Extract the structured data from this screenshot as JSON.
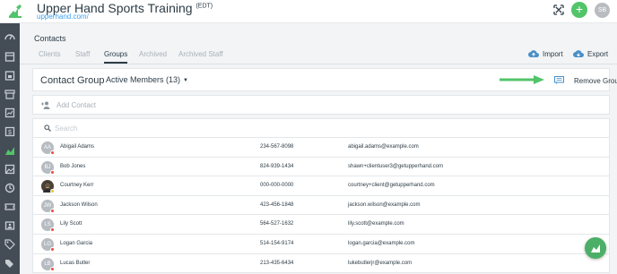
{
  "header": {
    "title": "Upper Hand Sports Training",
    "title_sup": "(EDT)",
    "subtitle": "upperhand.com/",
    "add_label": "+",
    "user_initials": "SB"
  },
  "sidebar": {
    "icons": [
      "dashboard-icon",
      "calendar-icon",
      "events-icon",
      "store-icon",
      "reports-icon",
      "money-icon",
      "contacts-icon",
      "image-icon",
      "clock-icon",
      "ticket-icon",
      "id-card-icon",
      "tag-icon",
      "tags-icon",
      "settings-icon"
    ]
  },
  "page": {
    "title": "Contacts",
    "tabs": [
      "Clients",
      "Staff",
      "Groups",
      "Archived",
      "Archived Staff"
    ],
    "active_tab": "Groups",
    "import_label": "Import",
    "export_label": "Export"
  },
  "group": {
    "label": "Contact Group",
    "selected": "Active Members (13)",
    "remove_label": "Remove Group"
  },
  "add_contact_label": "Add Contact",
  "search": {
    "placeholder": "Search"
  },
  "contacts": [
    {
      "initials": "AA",
      "name": "Abigail Adams",
      "phone": "234-567-8098",
      "email": "abigail.adams@example.com"
    },
    {
      "initials": "BJ",
      "name": "Bob Jones",
      "phone": "824-939-1434",
      "email": "shawn+clientuser3@getupperhand.com"
    },
    {
      "initials": "",
      "name": "Courtney Kerr",
      "phone": "000-000-0000",
      "email": "courtney+client@getupperhand.com"
    },
    {
      "initials": "JW",
      "name": "Jackson Wilson",
      "phone": "423-456-1848",
      "email": "jackson.wilson@example.com"
    },
    {
      "initials": "LS",
      "name": "Lily Scott",
      "phone": "564-527-1632",
      "email": "lily.scott@example.com"
    },
    {
      "initials": "LG",
      "name": "Logan Garcia",
      "phone": "514-154-9174",
      "email": "logan.garcia@example.com"
    },
    {
      "initials": "LB",
      "name": "Lucas Butler",
      "phone": "213-435-6434",
      "email": "lukebutlerjr@example.com"
    }
  ],
  "colors": {
    "accent_green": "#52c46a",
    "link_blue": "#3da0f0",
    "sidebar": "#444c56",
    "badge_red": "#e94b3c"
  }
}
